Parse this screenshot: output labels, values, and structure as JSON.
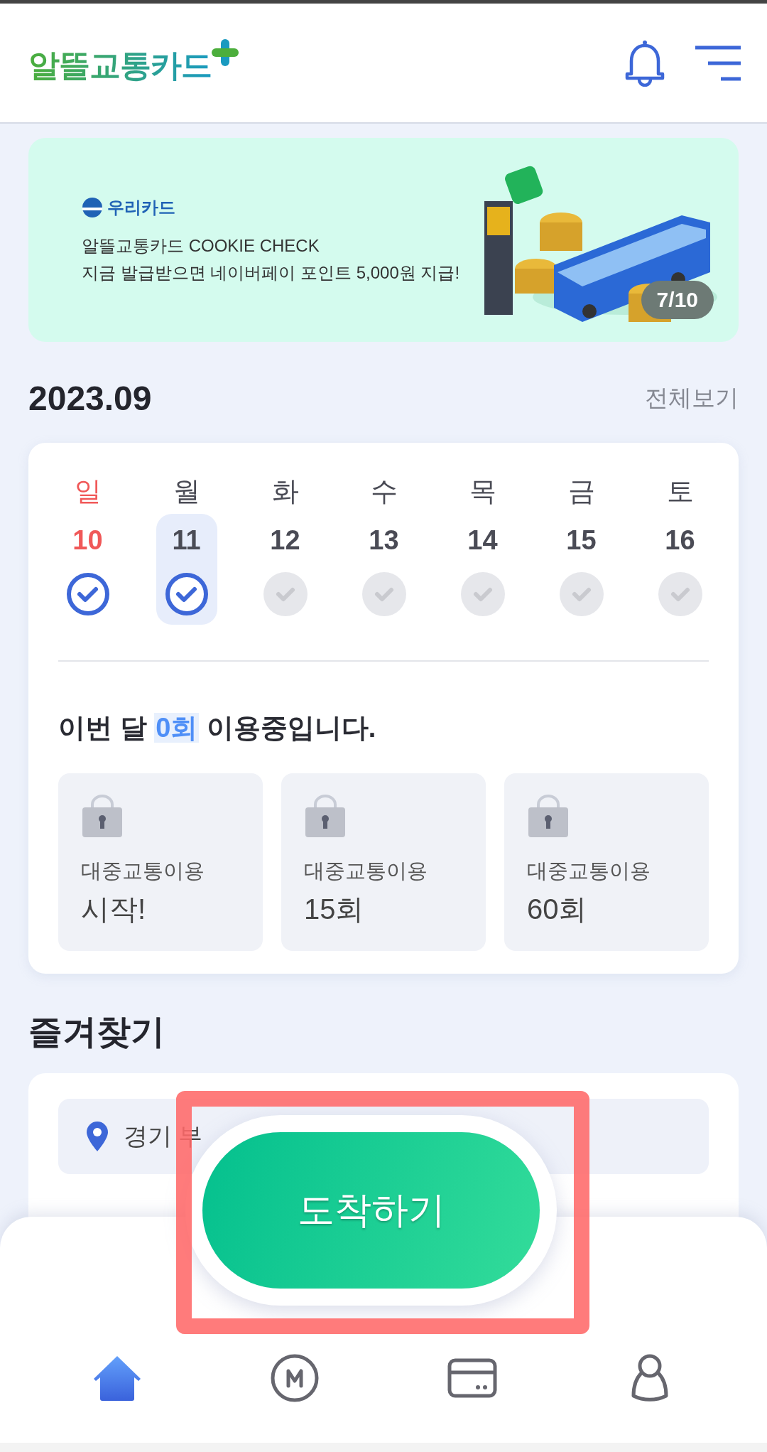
{
  "header": {
    "logo": "알뜰교통카드"
  },
  "banner": {
    "brand": "우리카드",
    "title": "알뜰교통카드 COOKIE CHECK",
    "subtitle": "지금 발급받으면 네이버페이 포인트 5,000원 지급!",
    "pager": "7/10"
  },
  "month": {
    "title": "2023.09",
    "link": "전체보기"
  },
  "week": [
    {
      "day": "일",
      "date": "10",
      "holiday": true,
      "checked": true,
      "selected": false
    },
    {
      "day": "월",
      "date": "11",
      "holiday": false,
      "checked": true,
      "selected": true
    },
    {
      "day": "화",
      "date": "12",
      "holiday": false,
      "checked": false,
      "selected": false
    },
    {
      "day": "수",
      "date": "13",
      "holiday": false,
      "checked": false,
      "selected": false
    },
    {
      "day": "목",
      "date": "14",
      "holiday": false,
      "checked": false,
      "selected": false
    },
    {
      "day": "금",
      "date": "15",
      "holiday": false,
      "checked": false,
      "selected": false
    },
    {
      "day": "토",
      "date": "16",
      "holiday": false,
      "checked": false,
      "selected": false
    }
  ],
  "usage": {
    "prefix": "이번 달",
    "count": "0회",
    "suffix": "이용중입니다."
  },
  "badges": [
    {
      "label": "대중교통이용",
      "value": "시작!",
      "locked": true
    },
    {
      "label": "대중교통이용",
      "value": "15회",
      "locked": true
    },
    {
      "label": "대중교통이용",
      "value": "60회",
      "locked": true
    }
  ],
  "favorites": {
    "title": "즐겨찾기",
    "items": [
      {
        "text": "경기 부"
      }
    ]
  },
  "arrive_button": {
    "label": "도착하기",
    "highlighted": true
  },
  "nav": [
    {
      "kind": "home",
      "selected": true
    },
    {
      "kind": "metro",
      "selected": false
    },
    {
      "kind": "card",
      "selected": false
    },
    {
      "kind": "profile",
      "selected": false
    }
  ]
}
